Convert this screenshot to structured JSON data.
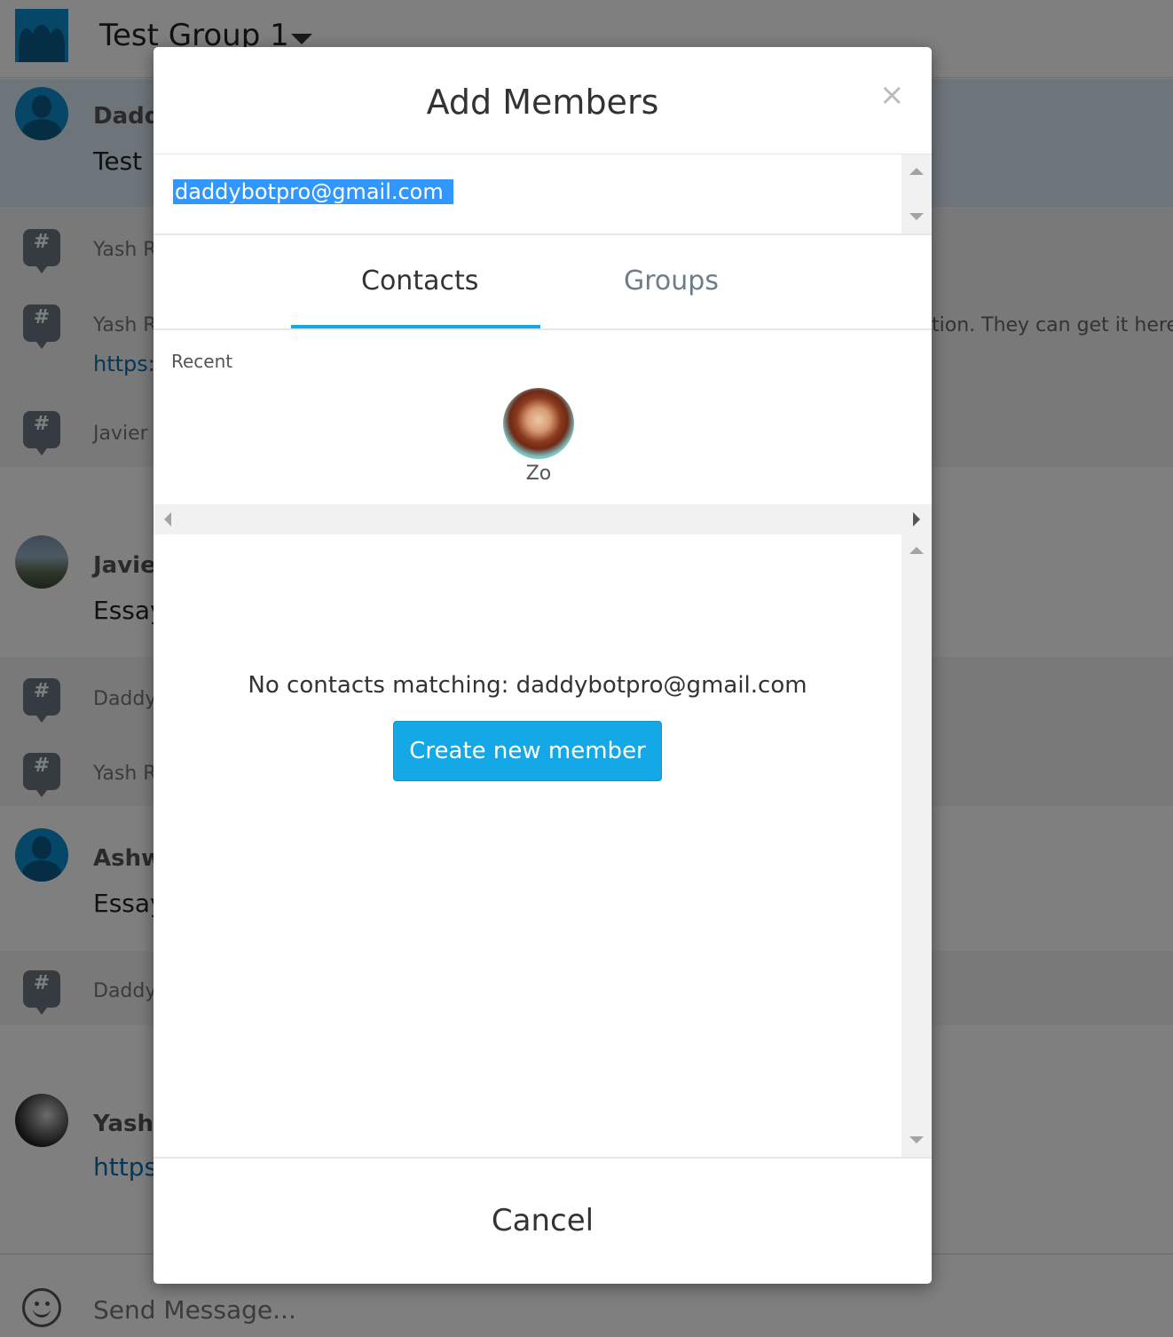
{
  "background": {
    "group_title": "Test Group 1",
    "rows": [
      {
        "name": "Daddy",
        "text": "Test"
      },
      {
        "sys_name": "Yash R"
      },
      {
        "sys_name": "Yash R",
        "link": "https:/",
        "right_text": "tion. They can get it here:"
      },
      {
        "sys_name": "Javier "
      },
      {
        "name": "Javier",
        "text": "Essay"
      },
      {
        "sys_name": "Daddy"
      },
      {
        "sys_name": "Yash R"
      },
      {
        "name": "Ashwi",
        "text": "Essay"
      },
      {
        "sys_name": "Daddy"
      },
      {
        "name": "Yash R",
        "link": "https"
      }
    ],
    "composer_placeholder": "Send Message..."
  },
  "modal": {
    "title": "Add Members",
    "close_glyph": "×",
    "email_value": "daddybotpro@gmail.com",
    "tabs": [
      {
        "label": "Contacts",
        "active": true
      },
      {
        "label": "Groups",
        "active": false
      }
    ],
    "recent_label": "Recent",
    "recent_contacts": [
      {
        "name": "Zo"
      }
    ],
    "no_match_text": "No contacts matching: daddybotpro@gmail.com",
    "create_button": "Create new member",
    "cancel_button": "Cancel"
  },
  "colors": {
    "accent": "#14a9e6",
    "selection": "#3297fd",
    "link": "#0b6fb0"
  },
  "icons": {
    "group": "group-avatar-icon",
    "system": "groupme-system-icon",
    "close": "close-icon",
    "smiley": "emoji-icon"
  }
}
